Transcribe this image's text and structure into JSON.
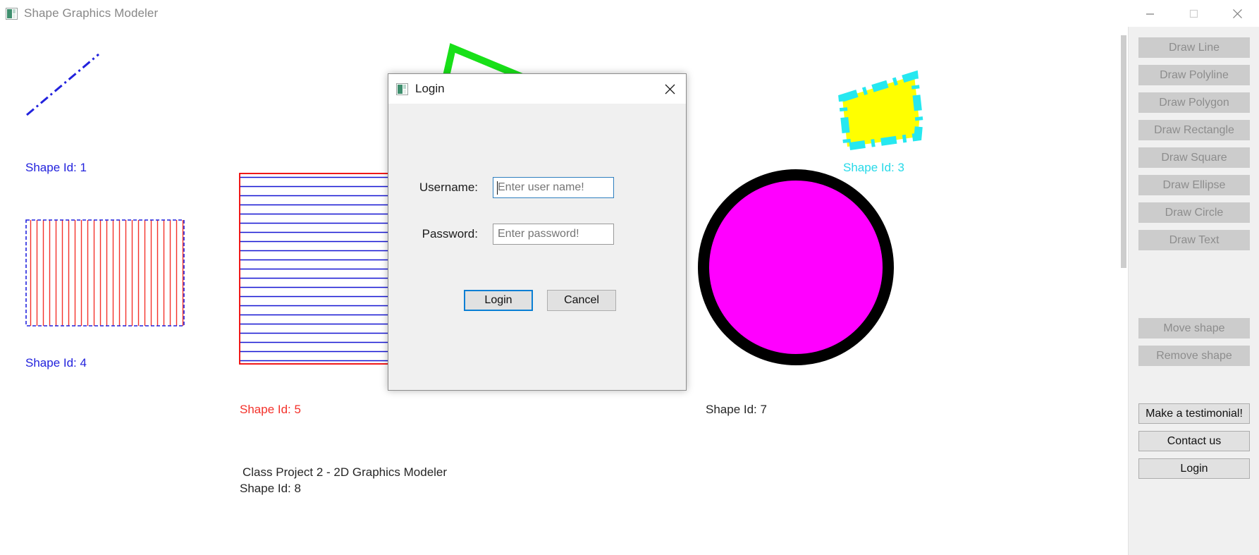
{
  "window": {
    "title": "Shape Graphics Modeler",
    "icon": "app-icon",
    "controls": {
      "minimize": "minimize-icon",
      "maximize": "maximize-icon",
      "close": "close-icon"
    }
  },
  "sidebar": {
    "buttons": [
      {
        "label": "Draw Line",
        "enabled": false,
        "name": "draw-line-button"
      },
      {
        "label": "Draw Polyline",
        "enabled": false,
        "name": "draw-polyline-button"
      },
      {
        "label": "Draw Polygon",
        "enabled": false,
        "name": "draw-polygon-button"
      },
      {
        "label": "Draw Rectangle",
        "enabled": false,
        "name": "draw-rectangle-button"
      },
      {
        "label": "Draw Square",
        "enabled": false,
        "name": "draw-square-button"
      },
      {
        "label": "Draw Ellipse",
        "enabled": false,
        "name": "draw-ellipse-button"
      },
      {
        "label": "Draw Circle",
        "enabled": false,
        "name": "draw-circle-button"
      },
      {
        "label": "Draw Text",
        "enabled": false,
        "name": "draw-text-button"
      },
      {
        "label": "Move shape",
        "enabled": false,
        "name": "move-shape-button"
      },
      {
        "label": "Remove shape",
        "enabled": false,
        "name": "remove-shape-button"
      },
      {
        "label": "Make a testimonial!",
        "enabled": true,
        "name": "make-testimonial-button"
      },
      {
        "label": "Contact us",
        "enabled": true,
        "name": "contact-us-button"
      },
      {
        "label": "Login",
        "enabled": true,
        "name": "login-button"
      }
    ]
  },
  "canvas": {
    "shape_labels": [
      {
        "text": "Shape Id: 1",
        "color": "#2222dd"
      },
      {
        "text": "Shape Id: 3",
        "color": "#26d9e8"
      },
      {
        "text": "Shape Id: 4",
        "color": "#2222dd"
      },
      {
        "text": "Shape Id: 5",
        "color": "#f4312a"
      },
      {
        "text": "Shape Id: 7",
        "color": "#262626"
      },
      {
        "text": "Shape Id: 8",
        "color": "#262626"
      }
    ],
    "text_shape": "Class Project 2 - 2D Graphics Modeler",
    "colors": {
      "line_blue": "#2222dd",
      "polyline_green": "#18e018",
      "polygon_fill_yellow": "#ffff00",
      "polygon_stroke_cyan": "#26e8f0",
      "rect_stroke_blue": "#2222dd",
      "rect_hatch_red": "#f4312a",
      "square_stroke_red": "#ee0000",
      "square_hatch_blue": "#1414d2",
      "circle_fill_magenta": "#ff00ff",
      "circle_stroke_black": "#000000"
    }
  },
  "dialog": {
    "title": "Login",
    "icon": "app-icon",
    "close_icon": "close-icon",
    "fields": [
      {
        "label": "Username:",
        "value": "",
        "placeholder": "Enter user name!",
        "focused": true
      },
      {
        "label": "Password:",
        "value": "",
        "placeholder": "Enter password!",
        "focused": false
      }
    ],
    "buttons": [
      {
        "label": "Login",
        "primary": true
      },
      {
        "label": "Cancel",
        "primary": false
      }
    ],
    "accent_color": "#0a7fd4"
  }
}
